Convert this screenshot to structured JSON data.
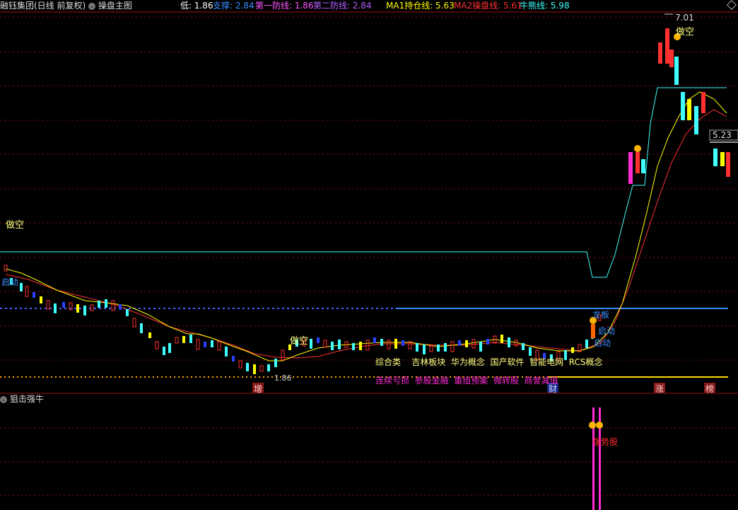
{
  "header": {
    "stock_title": "融钰集团(日线 前复权)",
    "indicator_menu": "操盘主图",
    "indicators": [
      {
        "label": "低: 1.86",
        "color": "#ffffff"
      },
      {
        "label": "支撑: 2.84",
        "color": "#3a8dff"
      },
      {
        "label": "第一防线: 1.86",
        "color": "#ff55ff"
      },
      {
        "label": "第二防线: 2.84",
        "color": "#b060ff"
      },
      {
        "label": "MA1持仓线: 5.63",
        "color": "#ffff00"
      },
      {
        "label": "MA2操盘线: 5.61",
        "color": "#ff3030"
      },
      {
        "label": "牛熊线: 5.98",
        "color": "#40ffff"
      }
    ]
  },
  "annotations": {
    "high_value": "7.01",
    "low_value": "1.86",
    "price_tag": "5.23",
    "short_sell_1": "做空",
    "short_sell_2": "做空",
    "short_sell_3": "做空",
    "launch_1": "启动",
    "launch_2": "启动",
    "launch_3": "启动",
    "dragon_board": "龙板",
    "concepts_1": "综合类    吉林板块  华为概念  国产软件  智能电网  RCS概念",
    "concepts_2": "连续亏损  参股金融  重组预案  微转股  商誉减值",
    "marker_zeng": "增",
    "marker_cai": "财",
    "marker_zhang": "涨",
    "marker_bang": "榜",
    "sub_signal": "强势股"
  },
  "subpanel": {
    "title": "狙击强牛"
  },
  "colors": {
    "up": "#ff3030",
    "down": "#40ffff",
    "ma1": "#ffff00",
    "ma2": "#ff3030",
    "bull_bear": "#40ffff",
    "support": "#3a8dff",
    "defense": "#ffd700",
    "grid": "#8a1010",
    "magenta": "#ff2bd5"
  }
}
